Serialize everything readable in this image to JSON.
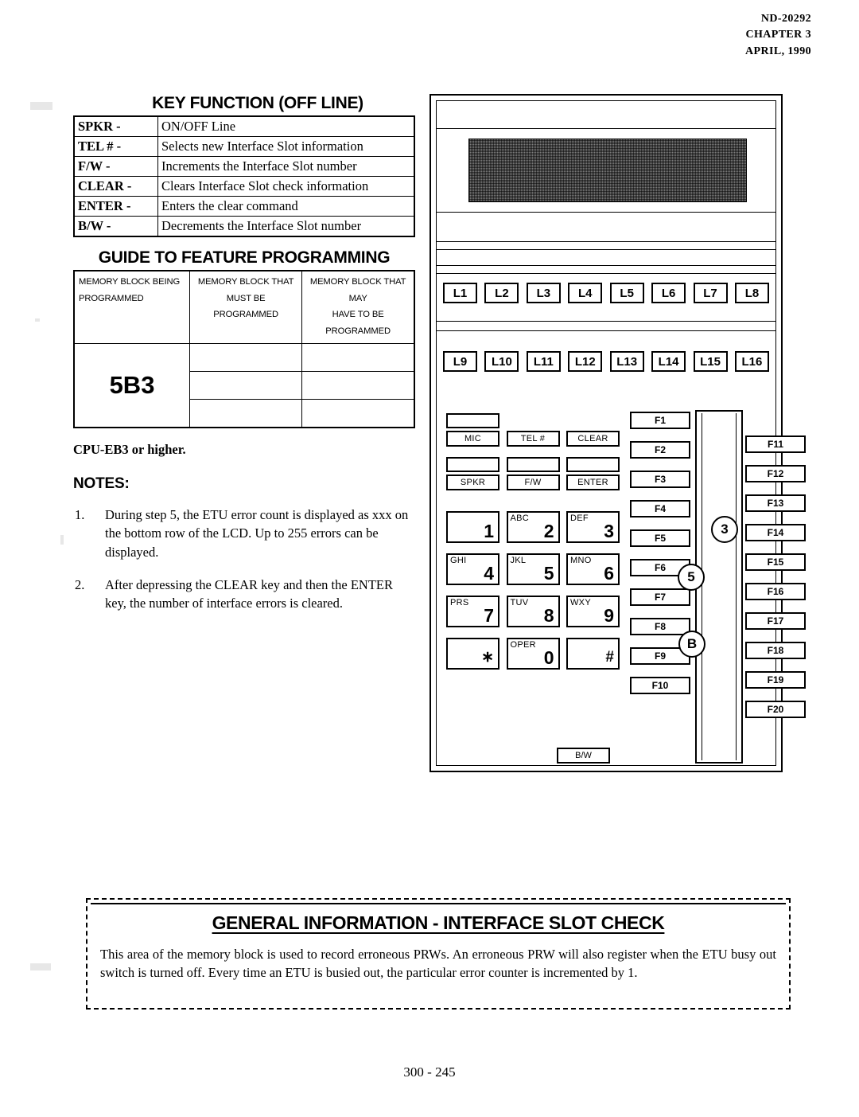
{
  "header": {
    "doc_number": "ND-20292",
    "chapter": "CHAPTER 3",
    "date": "APRIL, 1990"
  },
  "key_function": {
    "title": "KEY FUNCTION (OFF LINE)",
    "rows": [
      {
        "key": "SPKR -",
        "desc": "ON/OFF Line"
      },
      {
        "key": "TEL # -",
        "desc": "Selects new Interface Slot information"
      },
      {
        "key": "F/W  -",
        "desc": "Increments the Interface Slot number"
      },
      {
        "key": "CLEAR -",
        "desc": "Clears Interface Slot check information"
      },
      {
        "key": "ENTER -",
        "desc": "Enters the clear command"
      },
      {
        "key": "B/W  -",
        "desc": "Decrements the Interface Slot number"
      }
    ]
  },
  "guide": {
    "title": "GUIDE TO FEATURE PROGRAMMING",
    "headers": [
      "MEMORY BLOCK BEING PROGRAMMED",
      "MEMORY BLOCK THAT MUST BE PROGRAMMED",
      "MEMORY BLOCK THAT MAY HAVE TO BE PROGRAMMED"
    ],
    "header_lines": [
      [
        "MEMORY BLOCK BEING",
        "PROGRAMMED"
      ],
      [
        "MEMORY BLOCK THAT",
        "MUST BE PROGRAMMED"
      ],
      [
        "MEMORY BLOCK THAT MAY",
        "HAVE TO BE PROGRAMMED"
      ]
    ],
    "memory_block": "5B3",
    "must_be_programmed": [
      "",
      "",
      ""
    ],
    "may_have_to_be_programmed": [
      "",
      "",
      ""
    ]
  },
  "cpu_note": "CPU-EB3 or higher.",
  "notes": {
    "title": "NOTES:",
    "items": [
      {
        "num": "1.",
        "text": "During step 5, the ETU error count is displayed as xxx on the bottom row of the LCD.   Up to 255 errors  can be displayed."
      },
      {
        "num": "2.",
        "text": "After depressing the CLEAR key and then the ENTER key, the number of interface errors is cleared."
      }
    ]
  },
  "phone": {
    "line_keys_row1": [
      "L1",
      "L2",
      "L3",
      "L4",
      "L5",
      "L6",
      "L7",
      "L8"
    ],
    "line_keys_row2": [
      "L9",
      "L10",
      "L11",
      "L12",
      "L13",
      "L14",
      "L15",
      "L16"
    ],
    "function_keys": [
      "MIC",
      "TEL #",
      "CLEAR",
      "SPKR",
      "F/W",
      "ENTER"
    ],
    "bw_key": "B/W",
    "dial_keys": [
      {
        "letters": "",
        "digit": "1"
      },
      {
        "letters": "ABC",
        "digit": "2"
      },
      {
        "letters": "DEF",
        "digit": "3"
      },
      {
        "letters": "GHI",
        "digit": "4"
      },
      {
        "letters": "JKL",
        "digit": "5"
      },
      {
        "letters": "MNO",
        "digit": "6"
      },
      {
        "letters": "PRS",
        "digit": "7"
      },
      {
        "letters": "TUV",
        "digit": "8"
      },
      {
        "letters": "WXY",
        "digit": "9"
      },
      {
        "letters": "",
        "digit": "∗"
      },
      {
        "letters": "OPER",
        "digit": "0"
      },
      {
        "letters": "",
        "digit": "#"
      }
    ],
    "f_keys_left": [
      "F1",
      "F2",
      "F3",
      "F4",
      "F5",
      "F6",
      "F7",
      "F8",
      "F9",
      "F10"
    ],
    "f_keys_right": [
      "F11",
      "F12",
      "F13",
      "F14",
      "F15",
      "F16",
      "F17",
      "F18",
      "F19",
      "F20"
    ],
    "markers": [
      "3",
      "5",
      "B"
    ],
    "lcd_color": "#7d7d7d"
  },
  "general_info": {
    "title": "GENERAL INFORMATION  -  INTERFACE SLOT CHECK",
    "body": "This area of the memory block is used to record erroneous PRWs.  An erroneous PRW will also register when the ETU busy out switch is turned off.  Every time an ETU is busied out, the particular error counter is incremented by 1."
  },
  "footer": {
    "page_number": "300 - 245"
  }
}
